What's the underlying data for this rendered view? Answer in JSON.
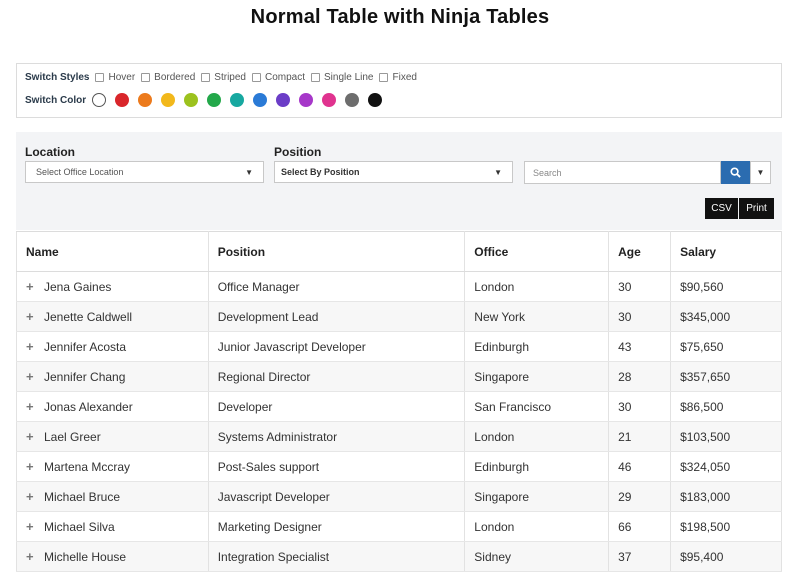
{
  "page": {
    "title": "Normal Table with Ninja Tables"
  },
  "style_panel": {
    "styles_label": "Switch Styles",
    "options": [
      "Hover",
      "Bordered",
      "Striped",
      "Compact",
      "Single Line",
      "Fixed"
    ],
    "colors_label": "Switch Color",
    "colors": [
      "#ffffff",
      "#d9262b",
      "#ec7a1c",
      "#f2b81b",
      "#9cc21e",
      "#23a84a",
      "#17a8a0",
      "#2a7ad6",
      "#6b3dc7",
      "#a637c9",
      "#e0338f",
      "#6d6d6d",
      "#111111"
    ]
  },
  "filters": {
    "location_label": "Location",
    "location_placeholder": "Select Office Location",
    "position_label": "Position",
    "position_placeholder": "Select By Position",
    "search_placeholder": "Search",
    "search_icon": "search-icon",
    "more_icon": "caret-down-icon",
    "csv_label": "CSV",
    "print_label": "Print"
  },
  "table": {
    "columns": [
      "Name",
      "Position",
      "Office",
      "Age",
      "Salary"
    ],
    "rows": [
      {
        "name": "Jena Gaines",
        "position": "Office Manager",
        "office": "London",
        "age": "30",
        "salary": "$90,560"
      },
      {
        "name": "Jenette Caldwell",
        "position": "Development Lead",
        "office": "New York",
        "age": "30",
        "salary": "$345,000"
      },
      {
        "name": "Jennifer Acosta",
        "position": "Junior Javascript Developer",
        "office": "Edinburgh",
        "age": "43",
        "salary": "$75,650"
      },
      {
        "name": "Jennifer Chang",
        "position": "Regional Director",
        "office": "Singapore",
        "age": "28",
        "salary": "$357,650"
      },
      {
        "name": "Jonas Alexander",
        "position": "Developer",
        "office": "San Francisco",
        "age": "30",
        "salary": "$86,500"
      },
      {
        "name": "Lael Greer",
        "position": "Systems Administrator",
        "office": "London",
        "age": "21",
        "salary": "$103,500"
      },
      {
        "name": "Martena Mccray",
        "position": "Post-Sales support",
        "office": "Edinburgh",
        "age": "46",
        "salary": "$324,050"
      },
      {
        "name": "Michael Bruce",
        "position": "Javascript Developer",
        "office": "Singapore",
        "age": "29",
        "salary": "$183,000"
      },
      {
        "name": "Michael Silva",
        "position": "Marketing Designer",
        "office": "London",
        "age": "66",
        "salary": "$198,500"
      },
      {
        "name": "Michelle House",
        "position": "Integration Specialist",
        "office": "Sidney",
        "age": "37",
        "salary": "$95,400"
      }
    ]
  }
}
